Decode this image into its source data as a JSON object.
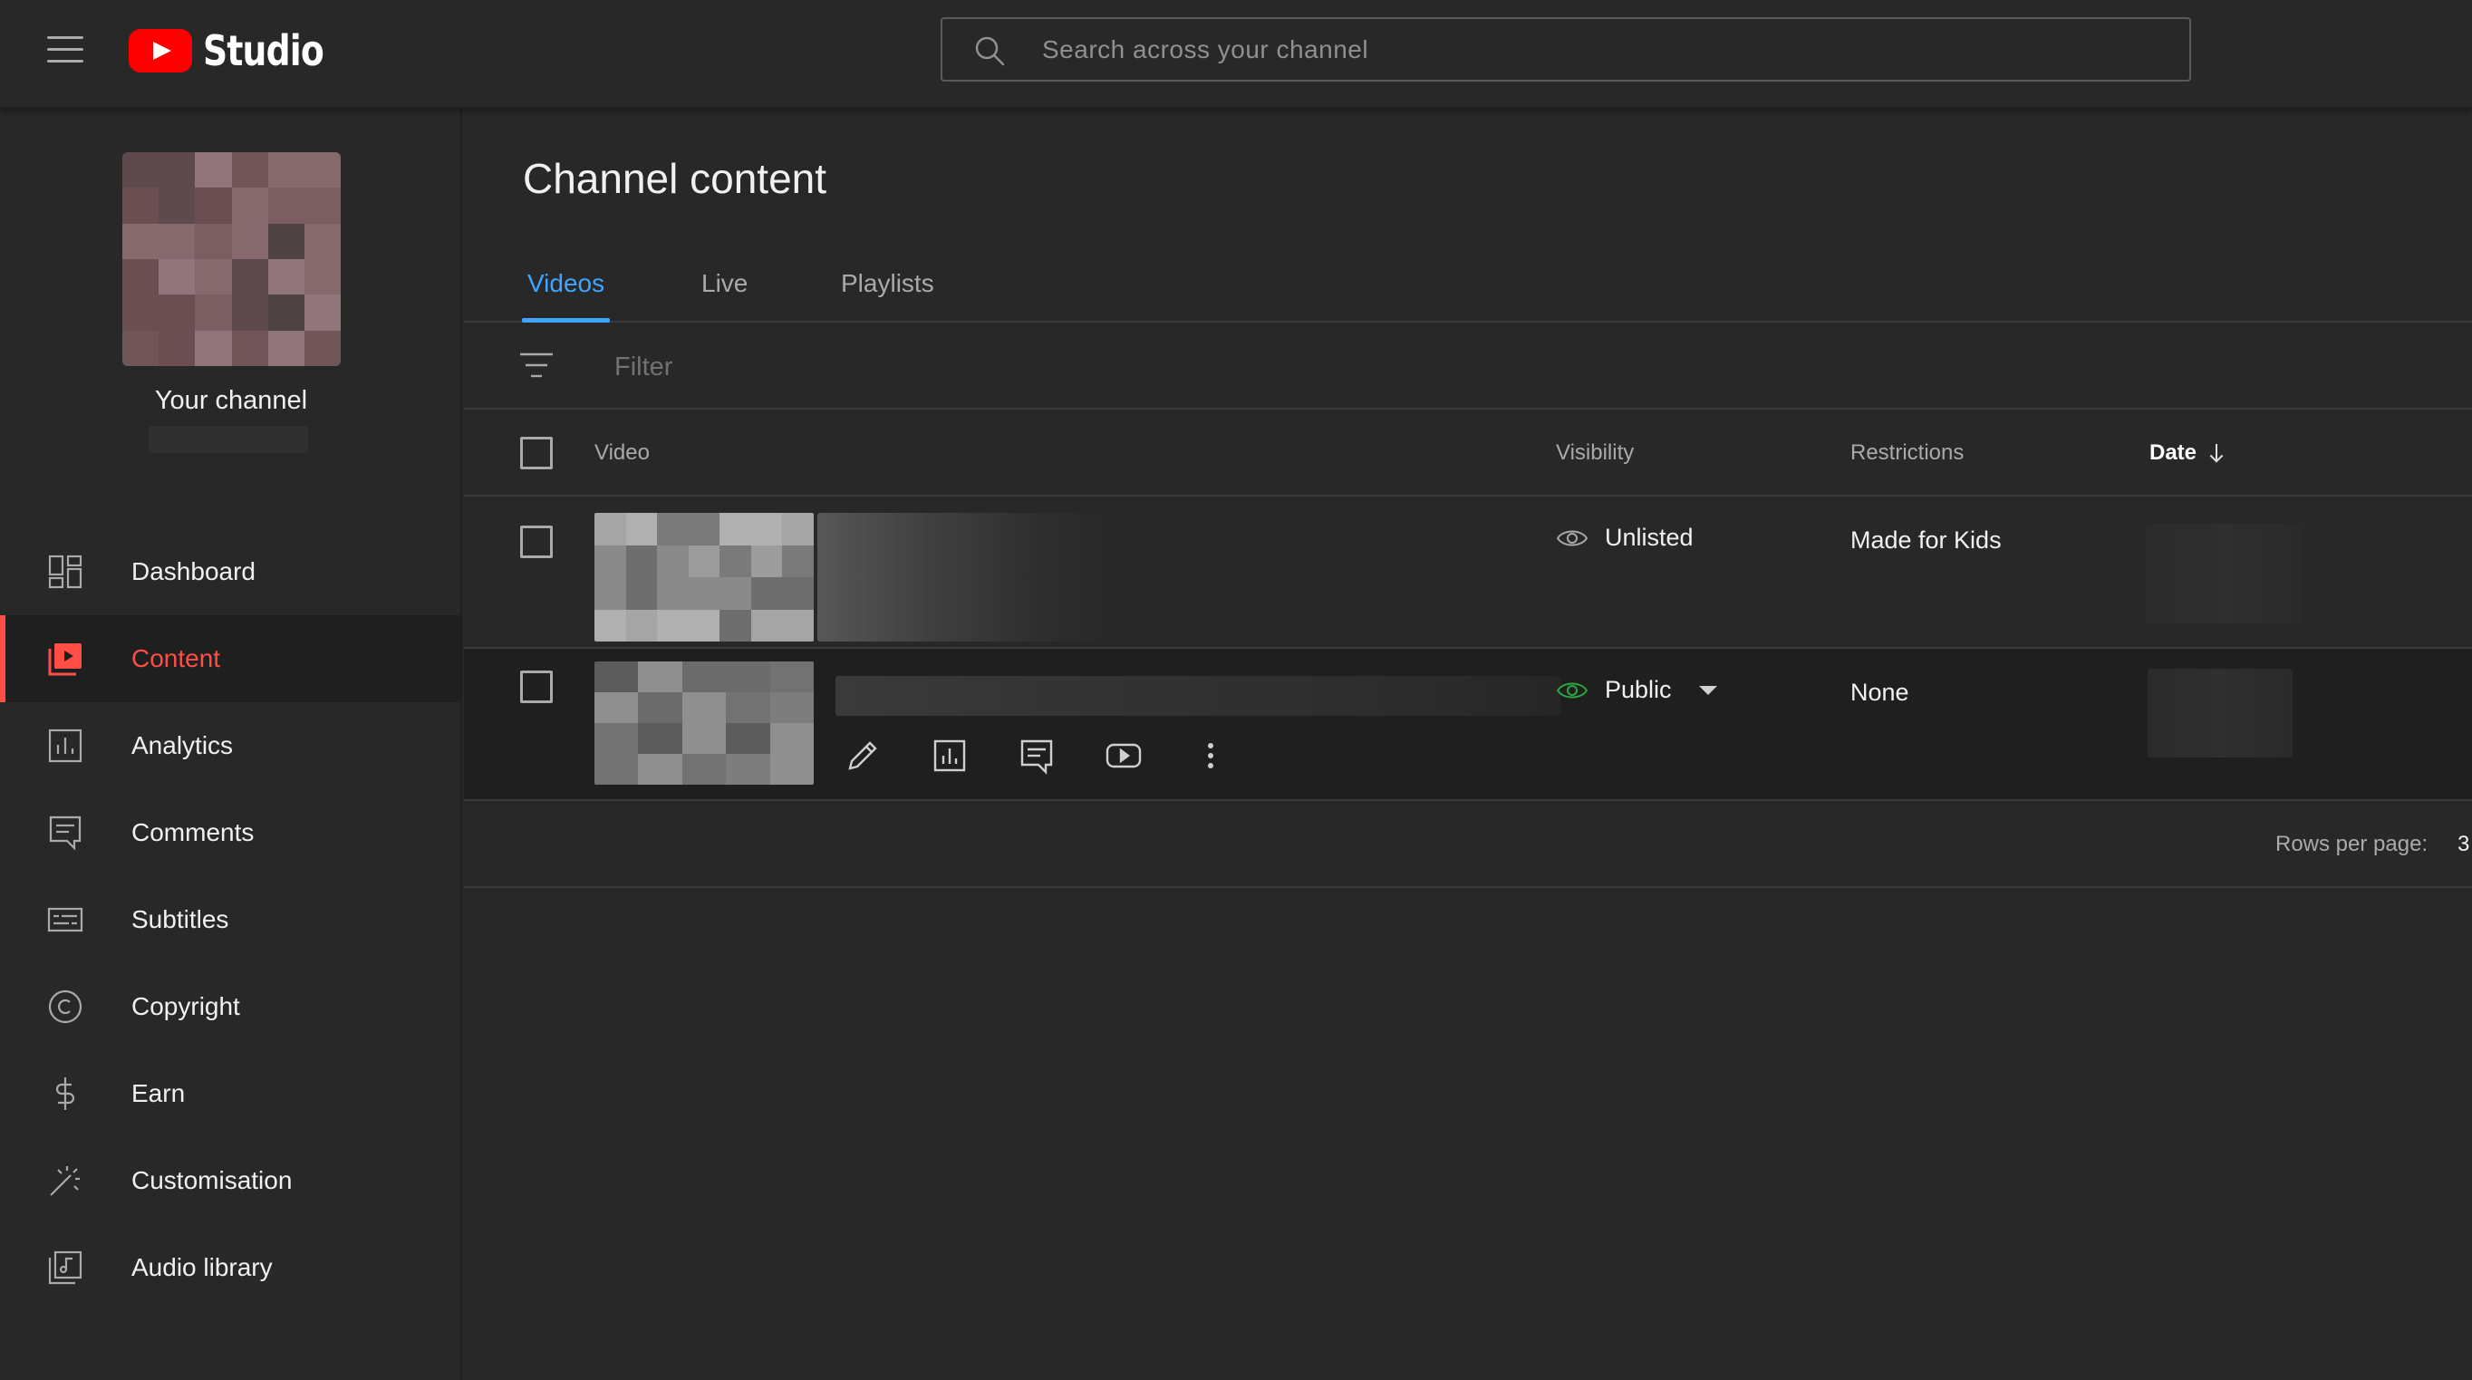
{
  "app": {
    "brand": "Studio",
    "icons": {
      "menu": "hamburger-menu-icon",
      "logo": "youtube-logo-icon",
      "search": "search-icon"
    }
  },
  "search": {
    "placeholder": "Search across your channel"
  },
  "sidebar": {
    "channel_label": "Your channel",
    "items": [
      {
        "label": "Dashboard",
        "icon": "dashboard-icon",
        "active": false
      },
      {
        "label": "Content",
        "icon": "content-icon",
        "active": true
      },
      {
        "label": "Analytics",
        "icon": "analytics-icon",
        "active": false
      },
      {
        "label": "Comments",
        "icon": "comments-icon",
        "active": false
      },
      {
        "label": "Subtitles",
        "icon": "subtitles-icon",
        "active": false
      },
      {
        "label": "Copyright",
        "icon": "copyright-icon",
        "active": false
      },
      {
        "label": "Earn",
        "icon": "earn-dollar-icon",
        "active": false
      },
      {
        "label": "Customisation",
        "icon": "magic-wand-icon",
        "active": false
      },
      {
        "label": "Audio library",
        "icon": "audio-library-icon",
        "active": false
      }
    ]
  },
  "main": {
    "title": "Channel content",
    "tabs": [
      {
        "label": "Videos",
        "active": true
      },
      {
        "label": "Live",
        "active": false
      },
      {
        "label": "Playlists",
        "active": false
      }
    ],
    "filter": {
      "placeholder": "Filter",
      "icon": "filter-icon"
    },
    "table": {
      "columns": {
        "video": "Video",
        "visibility": "Visibility",
        "restrictions": "Restrictions",
        "date": "Date"
      },
      "sort": {
        "column": "Date",
        "direction": "descending",
        "icon": "arrow-down-icon"
      },
      "rows": [
        {
          "visibility": "Unlisted",
          "visibility_icon": "eye-icon",
          "restrictions": "Made for Kids"
        },
        {
          "visibility": "Public",
          "visibility_icon": "eye-icon",
          "restrictions": "None",
          "actions": [
            "pencil-icon",
            "analytics-icon",
            "comments-icon",
            "youtube-play-icon",
            "more-vert-icon"
          ]
        }
      ]
    },
    "pagination": {
      "rows_per_page_label": "Rows per page:",
      "rows_per_page_value": "3"
    }
  },
  "colors": {
    "accent_tab": "#3ea6ff",
    "active_nav": "#ff4e45",
    "brand_red": "#ff0000",
    "public_eye": "#2ba640",
    "background": "#282828",
    "active_bg": "#1f1f1f"
  }
}
